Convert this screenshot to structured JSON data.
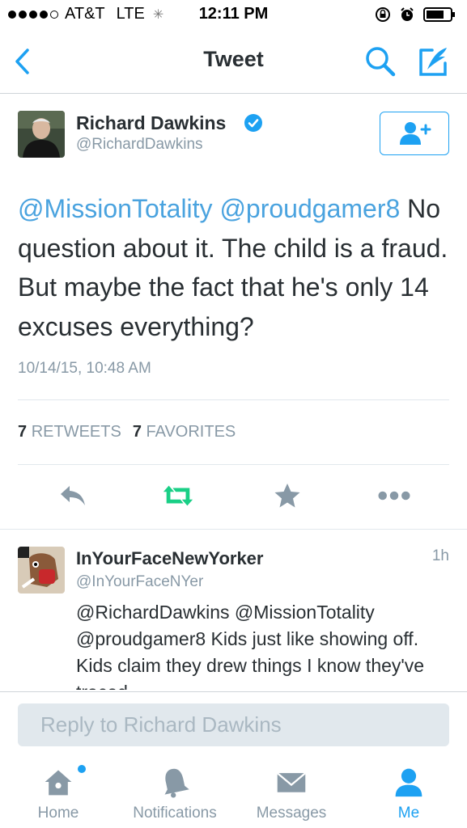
{
  "status_bar": {
    "carrier": "AT&T",
    "network": "LTE",
    "time": "12:11 PM",
    "signal_bars_filled": 4,
    "signal_bars_total": 5,
    "battery_level": 0.75
  },
  "nav": {
    "title": "Tweet",
    "back_icon": "chevron-left-icon",
    "search_icon": "search-icon",
    "compose_icon": "compose-icon"
  },
  "tweet": {
    "author_name": "Richard Dawkins",
    "author_handle": "@RichardDawkins",
    "verified": true,
    "mentions": "@MissionTotality @proudgamer8",
    "body": " No question about it. The child is a fraud. But maybe the fact that he's only 14 excuses everything?",
    "timestamp": "10/14/15, 10:48 AM",
    "retweets_count": "7",
    "retweets_label": "RETWEETS",
    "favorites_count": "7",
    "favorites_label": "FAVORITES"
  },
  "reply": {
    "author_name": "InYourFaceNewYorker",
    "author_handle": "@InYourFaceNYer",
    "time_ago": "1h",
    "text": "@RichardDawkins @MissionTotality @proudgamer8 Kids just like showing off. Kids claim they drew things I know they've traced."
  },
  "reply_bar": {
    "placeholder": "Reply to Richard Dawkins"
  },
  "tabs": [
    {
      "label": "Home",
      "icon": "home-icon",
      "active": false
    },
    {
      "label": "Notifications",
      "icon": "bell-icon",
      "active": false
    },
    {
      "label": "Messages",
      "icon": "envelope-icon",
      "active": false
    },
    {
      "label": "Me",
      "icon": "person-icon",
      "active": true
    }
  ],
  "colors": {
    "accent": "#1da1f2",
    "retweet_green": "#19cf86",
    "mention_blue": "#4aa3df",
    "muted": "#8899a6",
    "icon_gray": "#8899a6"
  }
}
